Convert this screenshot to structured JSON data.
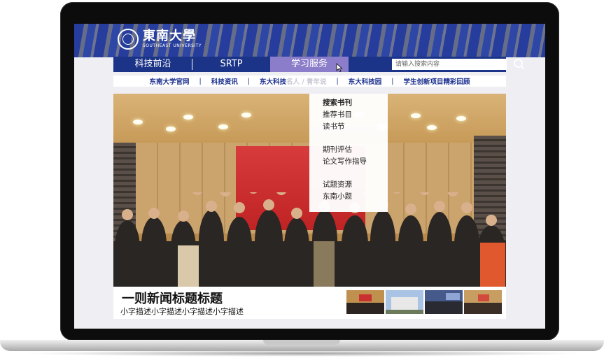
{
  "logo": {
    "name_cn": "東南大學",
    "name_en": "SOUTHEAST UNIVERSITY"
  },
  "nav": {
    "items": [
      {
        "label": "科技前沿"
      },
      {
        "label": "SRTP"
      },
      {
        "label": "学习服务"
      }
    ],
    "search_placeholder": "请输入搜索内容"
  },
  "quick_links": {
    "items": [
      "东南大学官网",
      "科技资讯",
      "东大科技",
      "东大科技园",
      "学生创新项目精彩回顾"
    ],
    "faded_text": "名人 / 青年说",
    "separator": "|"
  },
  "dropdown": {
    "groups": [
      [
        "搜索书刊",
        "推荐书目",
        "读书节"
      ],
      [
        "期刊评估",
        "论文写作指导"
      ],
      [
        "试题资源",
        "东南小题"
      ]
    ]
  },
  "news": {
    "title": "一则新闻标题标题",
    "description": "小字描述小字描述小字描述小字描述"
  },
  "colors": {
    "nav_bg": "#1c3488",
    "nav_active": "#8b7dc9",
    "link_color": "#1b2f8f"
  },
  "icons": {
    "search": "search-icon",
    "cursor": "cursor-icon",
    "seal": "university-seal-icon"
  }
}
